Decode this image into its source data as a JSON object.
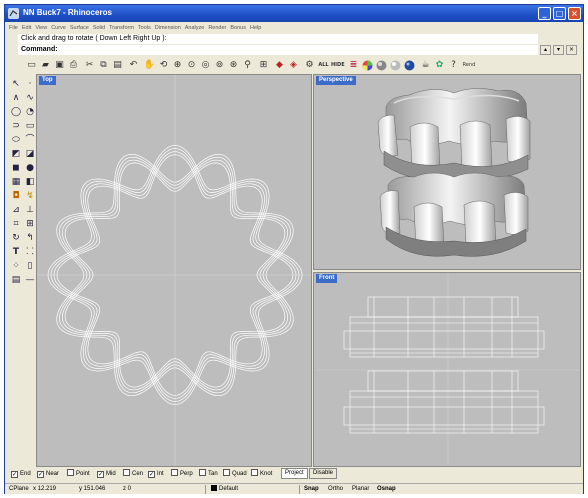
{
  "window": {
    "title": "NN Buck7 - Rhinoceros",
    "controls": {
      "minimize": "_",
      "maximize": "□",
      "close": "×"
    }
  },
  "menu": [
    "File",
    "Edit",
    "View",
    "Curve",
    "Surface",
    "Solid",
    "Transform",
    "Tools",
    "Dimension",
    "Analyze",
    "Render",
    "Bonus",
    "Help"
  ],
  "command": {
    "history": "Click and drag to rotate ( Down  Left  Right  Up ):",
    "prompt": "Command:"
  },
  "toolbar": {
    "icons": [
      "new-icon",
      "open-icon",
      "save-icon",
      "print-icon",
      "cut-icon",
      "copy-icon",
      "paste-icon",
      "undo-icon",
      "pan-icon",
      "rotate-view-icon",
      "zoom-window-icon",
      "zoom-dynamic-icon",
      "zoom-extents-icon",
      "zoom-selected-icon",
      "zoom-target-icon",
      "zoom-icon",
      "viewports-icon",
      "car-icon",
      "car2-icon",
      "settings-icon",
      "select-all-icon",
      "hide-icon",
      "layers-icon",
      "color-wheel-icon",
      "shaded-sphere-icon",
      "render-sphere-icon",
      "light-icon",
      "teapot-icon",
      "gear-icon",
      "help-icon"
    ],
    "all_label": "ALL",
    "hide_label": "HIDE",
    "render_label": "Rend"
  },
  "lefttoolbar": {
    "icons": [
      "select-arrow-icon",
      "point-icon",
      "polyline-icon",
      "curve-icon",
      "circle-icon",
      "arc-icon",
      "ellipse-icon",
      "rectangle-icon",
      "polygon-icon",
      "freeform-icon",
      "surface-icon",
      "loft-icon",
      "box-icon",
      "sphere-icon",
      "solid-icon",
      "boolean-icon",
      "text-icon",
      "dimension-icon",
      "transform-icon",
      "array-icon",
      "mirror-icon",
      "group-icon",
      "grid-icon",
      "properties-icon"
    ],
    "text_tool_label": "T"
  },
  "viewports": {
    "top": "Top",
    "perspective": "Perspective",
    "front": "Front"
  },
  "osnap": {
    "items": [
      {
        "label": "End",
        "checked": true
      },
      {
        "label": "Near",
        "checked": true
      },
      {
        "label": "Point",
        "checked": false
      },
      {
        "label": "Mid",
        "checked": true
      },
      {
        "label": "Cen",
        "checked": false
      },
      {
        "label": "Int",
        "checked": true
      },
      {
        "label": "Perp",
        "checked": false
      },
      {
        "label": "Tan",
        "checked": false
      },
      {
        "label": "Quad",
        "checked": false
      },
      {
        "label": "Knot",
        "checked": false
      }
    ],
    "project": "Project",
    "disable": "Disable",
    "checkmark": "✓"
  },
  "status": {
    "cplane": "CPlane",
    "x": "x 12.219",
    "y": "y 151.046",
    "z": "z 0",
    "layer": "Default",
    "snap": "Snap",
    "ortho": "Ortho",
    "planar": "Planar",
    "osnap": "Osnap"
  },
  "colors": {
    "titlebar": "#1d4fc4",
    "viewport_bg": "#bdbdbd",
    "viewport_label": "#3d6bc9",
    "wireframe": "#ffffff"
  }
}
